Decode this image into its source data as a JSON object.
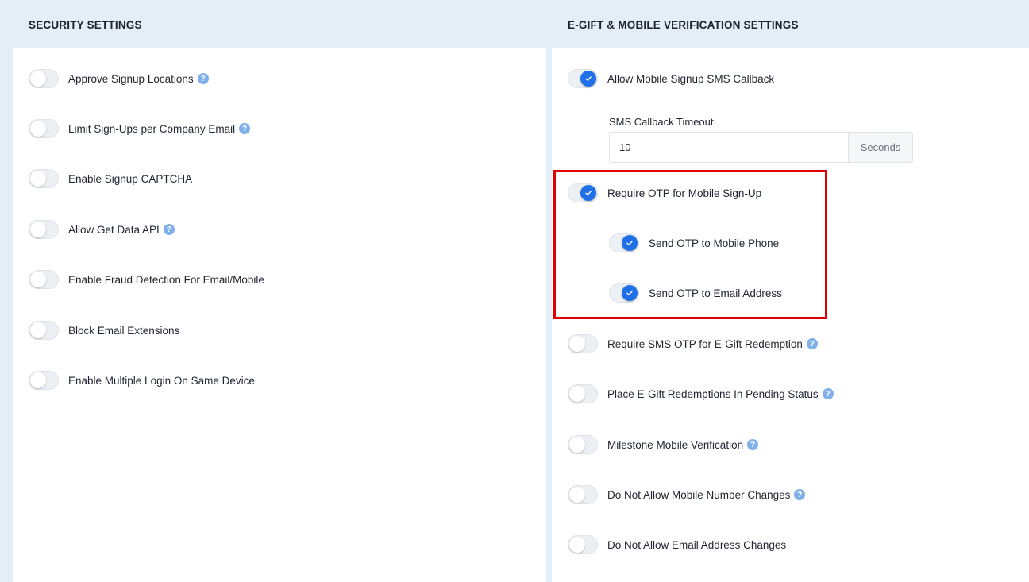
{
  "security": {
    "title": "SECURITY SETTINGS",
    "items": [
      {
        "label": "Approve Signup Locations",
        "on": false,
        "help": true
      },
      {
        "label": "Limit Sign-Ups per Company Email",
        "on": false,
        "help": true
      },
      {
        "label": "Enable Signup CAPTCHA",
        "on": false,
        "help": false
      },
      {
        "label": "Allow Get Data API",
        "on": false,
        "help": true
      },
      {
        "label": "Enable Fraud Detection For Email/Mobile",
        "on": false,
        "help": false
      },
      {
        "label": "Block Email Extensions",
        "on": false,
        "help": false
      },
      {
        "label": "Enable Multiple Login On Same Device",
        "on": false,
        "help": false
      }
    ]
  },
  "egift": {
    "title": "E-GIFT & MOBILE VERIFICATION SETTINGS",
    "sms_callback": {
      "label": "Allow Mobile Signup SMS Callback",
      "on": true
    },
    "timeout": {
      "label": "SMS Callback Timeout:",
      "value": "10",
      "unit": "Seconds"
    },
    "require_otp": {
      "label": "Require OTP for Mobile Sign-Up",
      "on": true
    },
    "otp_phone": {
      "label": "Send OTP to Mobile Phone",
      "on": true
    },
    "otp_email": {
      "label": "Send OTP to Email Address",
      "on": true
    },
    "items": [
      {
        "label": "Require SMS OTP for E-Gift Redemption",
        "on": false,
        "help": true
      },
      {
        "label": "Place E-Gift Redemptions In Pending Status",
        "on": false,
        "help": true
      },
      {
        "label": "Milestone Mobile Verification",
        "on": false,
        "help": true
      },
      {
        "label": "Do Not Allow Mobile Number Changes",
        "on": false,
        "help": true
      },
      {
        "label": "Do Not Allow Email Address Changes",
        "on": false,
        "help": false
      }
    ]
  },
  "help_glyph": "?",
  "colors": {
    "accent": "#1e6fe8",
    "highlight": "#e00000",
    "help": "#7fb0ec"
  }
}
